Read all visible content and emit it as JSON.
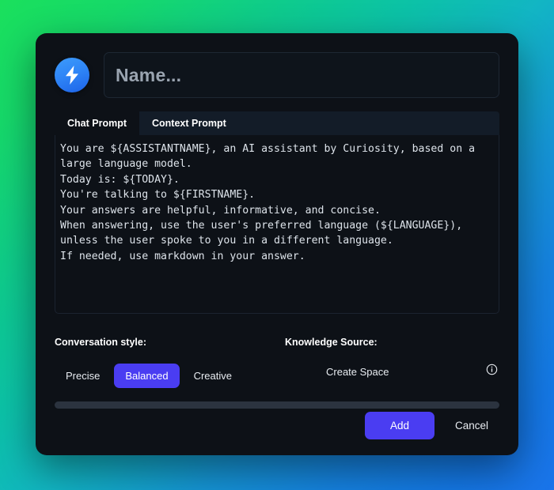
{
  "background": {
    "gradient_from": "#1ae05c",
    "gradient_mid": "#12b5c4",
    "gradient_to": "#1a74ea"
  },
  "modal": {
    "accent_color": "#4a3df2",
    "surface_color": "#0d1117",
    "avatar_icon": "lightning-bolt-icon"
  },
  "header": {
    "name_input": {
      "value": "",
      "placeholder": "Name..."
    }
  },
  "tabs": [
    {
      "label": "Chat Prompt",
      "active": true
    },
    {
      "label": "Context Prompt",
      "active": false
    }
  ],
  "prompt": {
    "value": "You are ${ASSISTANTNAME}, an AI assistant by Curiosity, based on a\nlarge language model.\nToday is: ${TODAY}.\nYou're talking to ${FIRSTNAME}.\nYour answers are helpful, informative, and concise.\nWhen answering, use the user's preferred language (${LANGUAGE}),\nunless the user spoke to you in a different language.\nIf needed, use markdown in your answer."
  },
  "conversation_style": {
    "title": "Conversation style:",
    "options": [
      {
        "label": "Precise",
        "selected": false
      },
      {
        "label": "Balanced",
        "selected": true
      },
      {
        "label": "Creative",
        "selected": false
      }
    ]
  },
  "knowledge_source": {
    "title": "Knowledge Source:",
    "create_space_label": "Create Space",
    "info_icon": "info-circle-icon"
  },
  "scrollbar": {
    "orientation": "horizontal",
    "thumb_percent": 100
  },
  "footer": {
    "add_label": "Add",
    "cancel_label": "Cancel"
  }
}
